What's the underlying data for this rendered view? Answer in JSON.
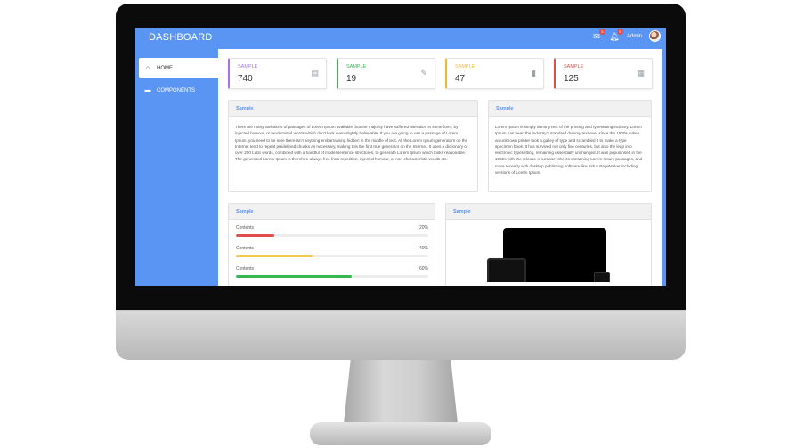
{
  "app": {
    "title": "DASHBOARD"
  },
  "topbar": {
    "mail_badge": "5",
    "notif_badge": "5",
    "user_name": "Admin"
  },
  "sidebar": {
    "items": [
      {
        "label": "HOME",
        "icon": "home-icon",
        "active": true
      },
      {
        "label": "COMPONENTS",
        "icon": "folder-icon",
        "active": false
      }
    ]
  },
  "stats": [
    {
      "label": "SAMPLE",
      "value": "740",
      "color": "#a874e0",
      "icon": "chat-icon"
    },
    {
      "label": "SAMPLE",
      "value": "19",
      "color": "#36b84f",
      "icon": "edit-note-icon"
    },
    {
      "label": "SAMPLE",
      "value": "47",
      "color": "#f2b82e",
      "icon": "bookmark-icon"
    },
    {
      "label": "SAMPLE",
      "value": "125",
      "color": "#e04d4d",
      "icon": "calendar-icon"
    }
  ],
  "cards": {
    "text_left": {
      "title": "Sample",
      "body": "There are many variations of passages of Lorem Ipsum available, but the majority have suffered alteration in some form, by injected humour, or randomised words which don't look even slightly believable. If you are going to use a passage of Lorem Ipsum, you need to be sure there isn't anything embarrassing hidden in the middle of text. All the Lorem Ipsum generators on the Internet tend to repeat predefined chunks as necessary, making this the first true generator on the Internet. It uses a dictionary of over 200 Latin words, combined with a handful of model sentence structures, to generate Lorem Ipsum which looks reasonable. The generated Lorem Ipsum is therefore always free from repetition, injected humour, or non-characteristic words etc."
    },
    "text_right": {
      "title": "Sample",
      "body": "Lorem Ipsum is simply dummy text of the printing and typesetting industry. Lorem Ipsum has been the industry's standard dummy text ever since the 1500s, when an unknown printer took a galley of type and scrambled it to make a type specimen book. It has survived not only five centuries, but also the leap into electronic typesetting, remaining essentially unchanged. It was popularised in the 1960s with the release of Letraset sheets containing Lorem Ipsum passages, and more recently with desktop publishing software like Aldus PageMaker including versions of Lorem Ipsum."
    },
    "progress": {
      "title": "Sample",
      "bars": [
        {
          "label": "Contents",
          "percent_label": "20%",
          "fraction": 0.2,
          "color": "#e04d4d"
        },
        {
          "label": "Contents",
          "percent_label": "40%",
          "fraction": 0.4,
          "color": "#f2c94c"
        },
        {
          "label": "Contents",
          "percent_label": "60%",
          "fraction": 0.6,
          "color": "#36b84f"
        }
      ]
    },
    "image": {
      "title": "Sample"
    }
  }
}
